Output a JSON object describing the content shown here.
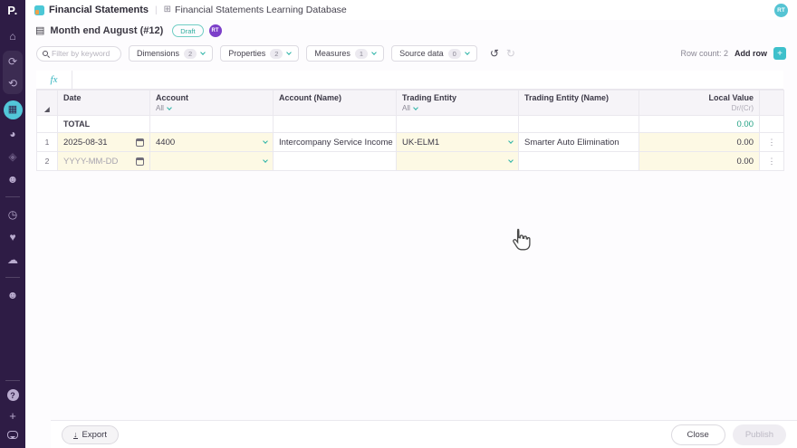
{
  "colors": {
    "sidebar_bg": "#2e1c45",
    "accent_teal": "#3ec0cb",
    "link_teal": "#2bb3a6",
    "active_icon_bg": "#52c6d8",
    "avatar_purple": "#7c3fc9",
    "editable_cell_yellow": "#fdf9e4",
    "total_green": "#21a183",
    "draft_badge": "#2fae9f"
  },
  "sidebar": {
    "logo": "P.",
    "icons": [
      {
        "name": "home",
        "glyph": "⌂"
      },
      {
        "name": "sync",
        "glyph": "⟳"
      },
      {
        "name": "workflow",
        "glyph": "⟲"
      },
      {
        "name": "database",
        "glyph": "▦"
      },
      {
        "name": "reports",
        "glyph": "◕"
      },
      {
        "name": "tags",
        "glyph": "◈"
      },
      {
        "name": "member",
        "glyph": "☻"
      },
      {
        "name": "history",
        "glyph": "◷"
      },
      {
        "name": "favorites",
        "glyph": "♥"
      },
      {
        "name": "media",
        "glyph": "☁"
      },
      {
        "name": "community",
        "glyph": "☻"
      }
    ],
    "help": "?",
    "add": "+"
  },
  "header": {
    "breadcrumb": {
      "app": "Financial Statements",
      "separator": "|",
      "grid_icon": "⊞",
      "page": "Financial Statements Learning Database"
    },
    "avatar": "RT"
  },
  "doc": {
    "journal_icon": "▤",
    "title": "Month end August (#12)",
    "status": "Draft",
    "avatar": "RT"
  },
  "toolbar": {
    "filter_placeholder": "Filter by keyword",
    "filters": [
      {
        "label": "Dimensions",
        "count": "2"
      },
      {
        "label": "Properties",
        "count": "2"
      },
      {
        "label": "Measures",
        "count": "1"
      },
      {
        "label": "Source data",
        "count": "0"
      }
    ],
    "undo_glyph": "↺",
    "redo_glyph": "↻",
    "row_count": "Row count: 2",
    "add_row": "Add row",
    "add_glyph": "+"
  },
  "table": {
    "formula_label": "fx",
    "select_all_glyph": "◢",
    "kebab_glyph": "⋮",
    "columns": [
      {
        "label": "Date"
      },
      {
        "label": "Account",
        "filter": "All"
      },
      {
        "label": "Account (Name)"
      },
      {
        "label": "Trading Entity",
        "filter": "All"
      },
      {
        "label": "Trading Entity (Name)"
      },
      {
        "label": "Local Value",
        "sub": "Dr/(Cr)"
      }
    ],
    "total": {
      "label": "TOTAL",
      "value": "0.00"
    },
    "rows": [
      {
        "num": "1",
        "date": "2025-08-31",
        "account": "4400",
        "account_name": "Intercompany Service Income",
        "trading_entity": "UK-ELM1",
        "trading_entity_name": "Smarter Auto Elimination",
        "local_value": "0.00"
      },
      {
        "num": "2",
        "date": "YYYY-MM-DD",
        "account": "",
        "account_name": "",
        "trading_entity": "",
        "trading_entity_name": "",
        "local_value": "0.00"
      }
    ]
  },
  "footer": {
    "export": "Export",
    "download_glyph": "↓",
    "close": "Close",
    "publish": "Publish"
  }
}
